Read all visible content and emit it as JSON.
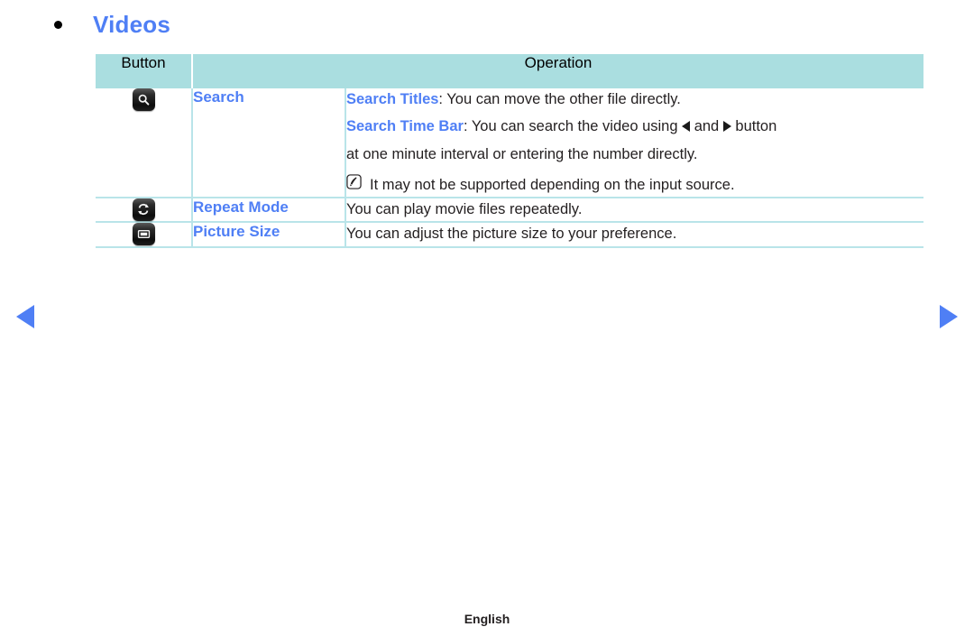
{
  "heading": {
    "bullet_icon": "bullet-dot-icon",
    "text": "Videos"
  },
  "colors": {
    "accent_blue": "#4f7ff5",
    "header_bg": "#aadee0",
    "border": "#b9e4e9",
    "text": "#231f20"
  },
  "table": {
    "headers": {
      "button": "Button",
      "operation": "Operation"
    },
    "rows": [
      {
        "icon": "search-key-icon",
        "label": "Search",
        "operation": {
          "lines": [
            {
              "keyword": "Search Titles",
              "separator": ": ",
              "text": "You can move the other file directly."
            },
            {
              "keyword": "Search Time Bar",
              "separator": ": ",
              "text_before_left_arrow": "You can search the video using ",
              "text_between_arrows": " and ",
              "text_after_right_arrow": " button"
            },
            {
              "text": "at one minute interval or entering the number directly."
            }
          ],
          "note": {
            "icon": "note-pen-icon",
            "text": "It may not be supported depending on the input source."
          }
        }
      },
      {
        "icon": "repeat-key-icon",
        "label": "Repeat Mode",
        "operation": {
          "lines": [
            {
              "text": "You can play movie files repeatedly."
            }
          ]
        }
      },
      {
        "icon": "picture-size-key-icon",
        "label": "Picture Size",
        "operation": {
          "lines": [
            {
              "text": "You can adjust the picture size to your preference."
            }
          ]
        }
      }
    ]
  },
  "navigation": {
    "prev_icon": "triangle-left-icon",
    "next_icon": "triangle-right-icon"
  },
  "footer": {
    "language": "English"
  }
}
